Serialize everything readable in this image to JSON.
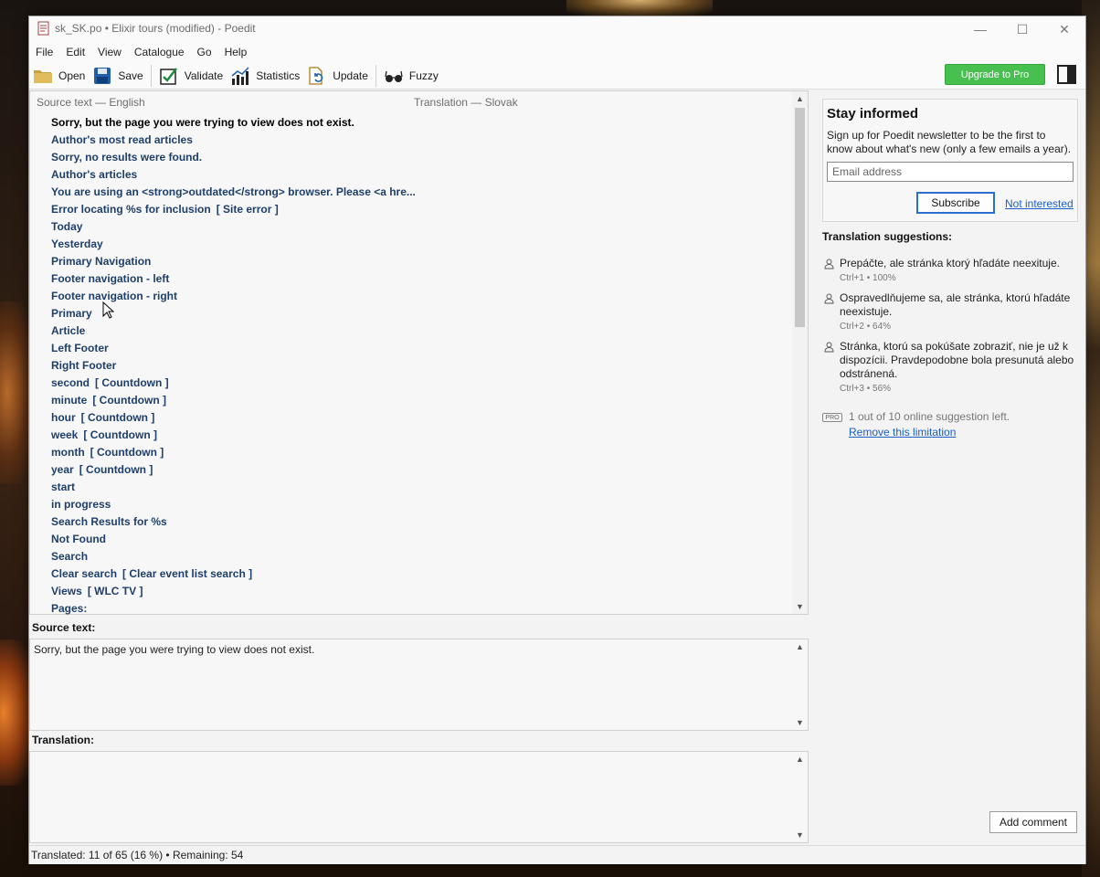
{
  "window": {
    "title": "sk_SK.po • Elixir tours (modified) - Poedit",
    "controls": {
      "minimize": "—",
      "maximize": "☐",
      "close": "✕"
    }
  },
  "menu": [
    "File",
    "Edit",
    "View",
    "Catalogue",
    "Go",
    "Help"
  ],
  "toolbar": {
    "open": "Open",
    "save": "Save",
    "validate": "Validate",
    "statistics": "Statistics",
    "update": "Update",
    "fuzzy": "Fuzzy",
    "upgrade": "Upgrade to Pro"
  },
  "list": {
    "source_header": "Source text — English",
    "translation_header": "Translation — Slovak",
    "rows": [
      {
        "text": "Sorry, but the page you were trying to view does not exist.",
        "ctx": ""
      },
      {
        "text": "Author's most read articles",
        "ctx": ""
      },
      {
        "text": "Sorry, no results were found.",
        "ctx": ""
      },
      {
        "text": "Author's articles",
        "ctx": ""
      },
      {
        "text": "You are using an <strong>outdated</strong> browser. Please <a hre...",
        "ctx": ""
      },
      {
        "text": "Error locating %s for inclusion",
        "ctx": "[ Site error ]"
      },
      {
        "text": "Today",
        "ctx": ""
      },
      {
        "text": "Yesterday",
        "ctx": ""
      },
      {
        "text": "Primary Navigation",
        "ctx": ""
      },
      {
        "text": "Footer navigation - left",
        "ctx": ""
      },
      {
        "text": "Footer navigation - right",
        "ctx": ""
      },
      {
        "text": "Primary",
        "ctx": ""
      },
      {
        "text": "Article",
        "ctx": ""
      },
      {
        "text": "Left Footer",
        "ctx": ""
      },
      {
        "text": "Right Footer",
        "ctx": ""
      },
      {
        "text": "second",
        "ctx": "[ Countdown ]"
      },
      {
        "text": "minute",
        "ctx": "[ Countdown ]"
      },
      {
        "text": "hour",
        "ctx": "[ Countdown ]"
      },
      {
        "text": "week",
        "ctx": "[ Countdown ]"
      },
      {
        "text": "month",
        "ctx": "[ Countdown ]"
      },
      {
        "text": "year",
        "ctx": "[ Countdown ]"
      },
      {
        "text": "start",
        "ctx": ""
      },
      {
        "text": "in progress",
        "ctx": ""
      },
      {
        "text": "Search Results for %s",
        "ctx": ""
      },
      {
        "text": "Not Found",
        "ctx": ""
      },
      {
        "text": "Search",
        "ctx": ""
      },
      {
        "text": "Clear search",
        "ctx": "[ Clear event list search ]"
      },
      {
        "text": "Views",
        "ctx": "[ WLC TV ]"
      },
      {
        "text": "Pages:",
        "ctx": ""
      }
    ]
  },
  "editor": {
    "source_label": "Source text:",
    "source_value": "Sorry, but the page you were trying to view does not exist.",
    "translation_label": "Translation:",
    "translation_value": ""
  },
  "sidebar": {
    "news_title": "Stay informed",
    "news_text": "Sign up for Poedit newsletter to be the first to know about what's new (only a few emails a year).",
    "email_placeholder": "Email address",
    "subscribe": "Subscribe",
    "not_interested": "Not interested",
    "suggestions_title": "Translation suggestions:",
    "suggestions": [
      {
        "text": "Prepáčte, ale stránka ktorý hľadáte neexituje.",
        "meta": "Ctrl+1 • 100%"
      },
      {
        "text": "Ospravedlňujeme sa, ale stránka, ktorú hľadáte neexistuje.",
        "meta": "Ctrl+2 • 64%"
      },
      {
        "text": "Stránka, ktorú sa pokúšate zobraziť, nie je už k dispozícii. Pravdepodobne bola presunutá alebo odstránená.",
        "meta": "Ctrl+3 • 56%"
      }
    ],
    "pro_badge": "PRO",
    "limit_text": "1 out of 10 online suggestion left.",
    "limit_link": "Remove this limitation",
    "add_comment": "Add comment"
  },
  "status": "Translated: 11 of 65 (16 %)  •  Remaining: 54",
  "colors": {
    "accent": "#2a6fd0",
    "upgrade": "#48c050",
    "row_text": "#1e3f6b"
  }
}
